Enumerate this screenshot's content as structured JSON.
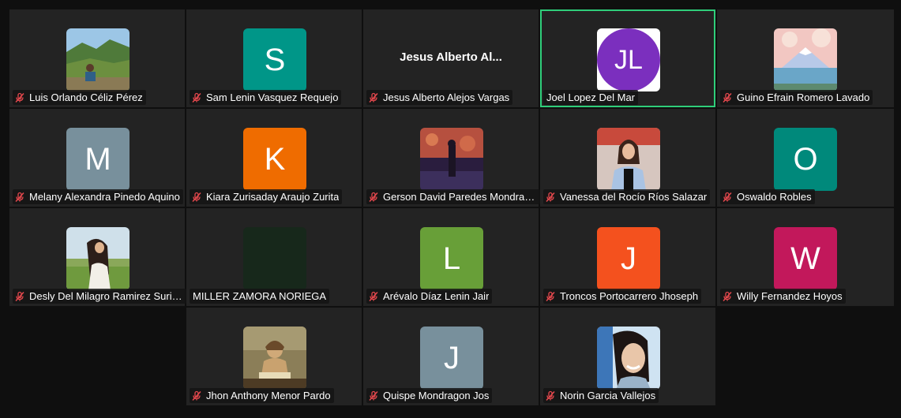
{
  "participants": [
    {
      "name": "Luis Orlando Céliz Pérez",
      "avatar_type": "photo",
      "photo": "landscape-mountain-person",
      "muted": true
    },
    {
      "name": "Sam Lenin Vasquez Requejo",
      "avatar_type": "initial",
      "initial": "S",
      "color": "#009688",
      "muted": true
    },
    {
      "name": "Jesus Alberto Alejos Vargas",
      "avatar_type": "name",
      "display_name": "Jesus Alberto Al...",
      "muted": true
    },
    {
      "name": "Joel Lopez Del Mar",
      "avatar_type": "initials-circle",
      "initial": "JL",
      "color": "#7b2fbe",
      "muted": false,
      "active_speaker": true
    },
    {
      "name": "Guino Efrain Romero Lavado",
      "avatar_type": "photo",
      "photo": "pastel-mountain-lake",
      "muted": true
    },
    {
      "name": "Melany Alexandra Pinedo Aquino",
      "avatar_type": "initial",
      "initial": "M",
      "color": "#78909c",
      "muted": true
    },
    {
      "name": "Kiara Zurisaday Araujo Zurita",
      "avatar_type": "initial",
      "initial": "K",
      "color": "#ef6c00",
      "muted": true
    },
    {
      "name": "Gerson David Paredes Mondrag...",
      "avatar_type": "photo",
      "photo": "anime-figure-night-sky",
      "muted": true
    },
    {
      "name": "Vanessa del Rocío Ríos Salazar",
      "avatar_type": "photo",
      "photo": "woman-selfie",
      "muted": true
    },
    {
      "name": "Oswaldo Robles",
      "avatar_type": "initial",
      "initial": "O",
      "color": "#00897b",
      "muted": true
    },
    {
      "name": "Desly Del Milagro Ramirez Suric...",
      "avatar_type": "photo",
      "photo": "woman-field",
      "muted": true
    },
    {
      "name": "MILLER ZAMORA NORIEGA",
      "avatar_type": "dark",
      "color": "#17281b",
      "muted": false
    },
    {
      "name": "Arévalo Díaz Lenin Jair",
      "avatar_type": "initial",
      "initial": "L",
      "color": "#689f38",
      "muted": true
    },
    {
      "name": "Troncos Portocarrero Jhoseph",
      "avatar_type": "initial",
      "initial": "J",
      "color": "#f4511e",
      "muted": true
    },
    {
      "name": "Willy Fernandez Hoyos",
      "avatar_type": "initial",
      "initial": "W",
      "color": "#c2185b",
      "muted": true
    },
    {
      "name": "Jhon Anthony Menor Pardo",
      "avatar_type": "photo",
      "photo": "painting-reading",
      "muted": true
    },
    {
      "name": "Quispe Mondragon Jos",
      "avatar_type": "initial",
      "initial": "J",
      "color": "#78909c",
      "muted": true
    },
    {
      "name": "Norin Garcia Vallejos",
      "avatar_type": "photo",
      "photo": "woman-selfie-2",
      "muted": true
    }
  ],
  "colors": {
    "background": "#0f0f0f",
    "tile": "#232323",
    "active_border": "#2fce7a",
    "mute_icon": "#e5484d"
  }
}
